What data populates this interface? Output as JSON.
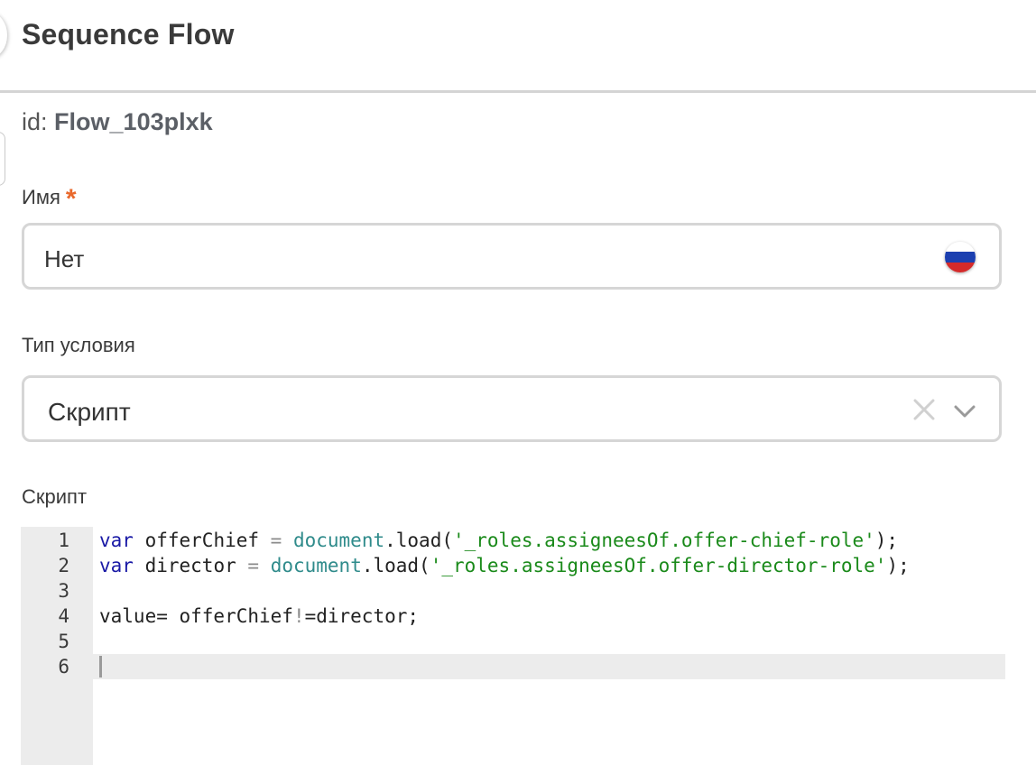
{
  "header": {
    "title": "Sequence Flow"
  },
  "element": {
    "id_label": "id:",
    "id_value": "Flow_103plxk"
  },
  "name_field": {
    "label": "Имя",
    "required_mark": "*",
    "value": "Нет",
    "language_icon": "russia-flag-icon"
  },
  "condition_field": {
    "label": "Тип условия",
    "value": "Скрипт",
    "clear_icon": "close-icon",
    "dropdown_icon": "chevron-down-icon"
  },
  "script_field": {
    "label": "Скрипт",
    "active_line": 6,
    "lines": [
      {
        "num": "1",
        "tokens": [
          {
            "t": "var",
            "c": "kw"
          },
          {
            "t": " offerChief ",
            "c": ""
          },
          {
            "t": "=",
            "c": "op"
          },
          {
            "t": " ",
            "c": ""
          },
          {
            "t": "document",
            "c": "obj"
          },
          {
            "t": ".load(",
            "c": ""
          },
          {
            "t": "'_roles.assigneesOf.offer-chief-role'",
            "c": "str"
          },
          {
            "t": ");",
            "c": ""
          }
        ]
      },
      {
        "num": "2",
        "tokens": [
          {
            "t": "var",
            "c": "kw"
          },
          {
            "t": " director ",
            "c": ""
          },
          {
            "t": "=",
            "c": "op"
          },
          {
            "t": " ",
            "c": ""
          },
          {
            "t": "document",
            "c": "obj"
          },
          {
            "t": ".load(",
            "c": ""
          },
          {
            "t": "'_roles.assigneesOf.offer-director-role'",
            "c": "str"
          },
          {
            "t": ");",
            "c": ""
          }
        ]
      },
      {
        "num": "3",
        "tokens": []
      },
      {
        "num": "4",
        "tokens": [
          {
            "t": "value= offerChief",
            "c": ""
          },
          {
            "t": "!",
            "c": "op"
          },
          {
            "t": "=director;",
            "c": ""
          }
        ]
      },
      {
        "num": "5",
        "tokens": []
      },
      {
        "num": "6",
        "tokens": []
      }
    ]
  }
}
